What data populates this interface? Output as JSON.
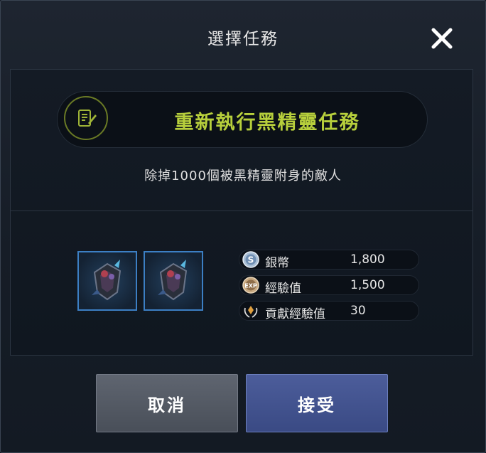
{
  "dialog": {
    "title": "選擇任務",
    "close_icon": "close-icon"
  },
  "quest": {
    "icon": "quest-scroll-icon",
    "name": "重新執行黑精靈任務",
    "description": "除掉1000個被黑精靈附身的敵人",
    "accent_color": "#b7cf3c"
  },
  "items": [
    {
      "icon": "dark-elf-armor-item"
    },
    {
      "icon": "dark-elf-armor-item"
    }
  ],
  "rewards": [
    {
      "icon": "silver-coin-icon",
      "label": "銀幣",
      "value": "1,800"
    },
    {
      "icon": "exp-icon",
      "label": "經驗值",
      "value": "1,500"
    },
    {
      "icon": "contribution-icon",
      "label": "貢獻經驗值",
      "value": "30"
    }
  ],
  "buttons": {
    "cancel": "取消",
    "accept": "接受"
  }
}
